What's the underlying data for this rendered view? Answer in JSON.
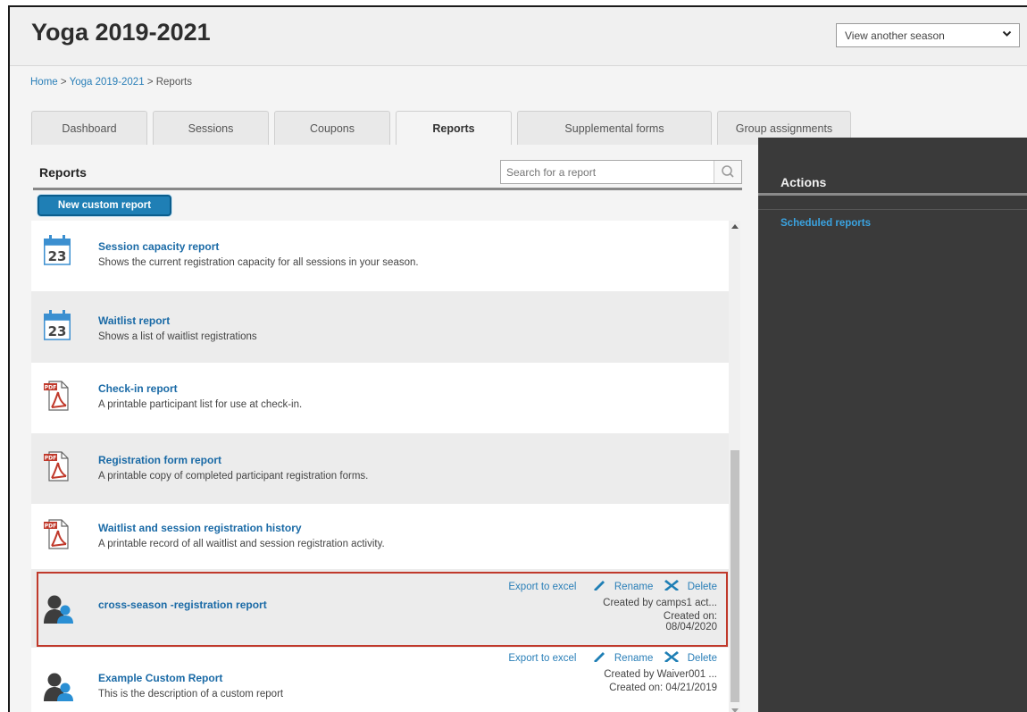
{
  "header": {
    "title": "Yoga 2019-2021",
    "season_select": "View another season"
  },
  "breadcrumb": {
    "home": "Home",
    "sep1": ">",
    "season": "Yoga 2019-2021",
    "sep2": ">",
    "current": "Reports"
  },
  "tabs": [
    {
      "label": "Dashboard"
    },
    {
      "label": "Sessions"
    },
    {
      "label": "Coupons"
    },
    {
      "label": "Reports",
      "active": true
    },
    {
      "label": "Supplemental forms"
    },
    {
      "label": "Group assignments"
    }
  ],
  "reports_panel": {
    "heading": "Reports",
    "search_placeholder": "Search for a report",
    "new_button": "New custom report"
  },
  "reports": [
    {
      "title": "Session capacity report",
      "description": "Shows the current registration capacity for all sessions in your season.",
      "icon": "calendar-icon",
      "calendar_day": "23"
    },
    {
      "title": "Waitlist report",
      "description": "Shows a list of waitlist registrations",
      "icon": "calendar-icon",
      "calendar_day": "23"
    },
    {
      "title": "Check-in report",
      "description": "A printable participant list for use at check-in.",
      "icon": "pdf-icon",
      "pdf_badge": "PDF"
    },
    {
      "title": "Registration form report",
      "description": "A printable copy of completed participant registration forms.",
      "icon": "pdf-icon",
      "pdf_badge": "PDF"
    },
    {
      "title": "Waitlist and session registration history",
      "description": "A printable record of all waitlist and session registration activity.",
      "icon": "pdf-icon",
      "pdf_badge": "PDF"
    },
    {
      "title": "cross-season -registration report",
      "icon": "users-icon",
      "export": "Export to excel",
      "rename": "Rename",
      "delete": "Delete",
      "created_by": "Created by camps1 act...",
      "created_on_label": "Created on:",
      "created_on_date": "08/04/2020"
    },
    {
      "title": "Example Custom Report",
      "description": "This is the description of a custom report",
      "icon": "users-icon",
      "export": "Export to excel",
      "rename": "Rename",
      "delete": "Delete",
      "created_by": "Created by Waiver001 ...",
      "created_on": "Created on: 04/21/2019"
    }
  ],
  "actions_panel": {
    "heading": "Actions",
    "scheduled_reports": "Scheduled reports"
  },
  "colors": {
    "link": "#1a6aa6",
    "accent_button": "#1f7fb5",
    "highlight_border": "#c0392b",
    "sidebar_bg": "#3a3a3a",
    "sidebar_link": "#3aa3e0"
  }
}
